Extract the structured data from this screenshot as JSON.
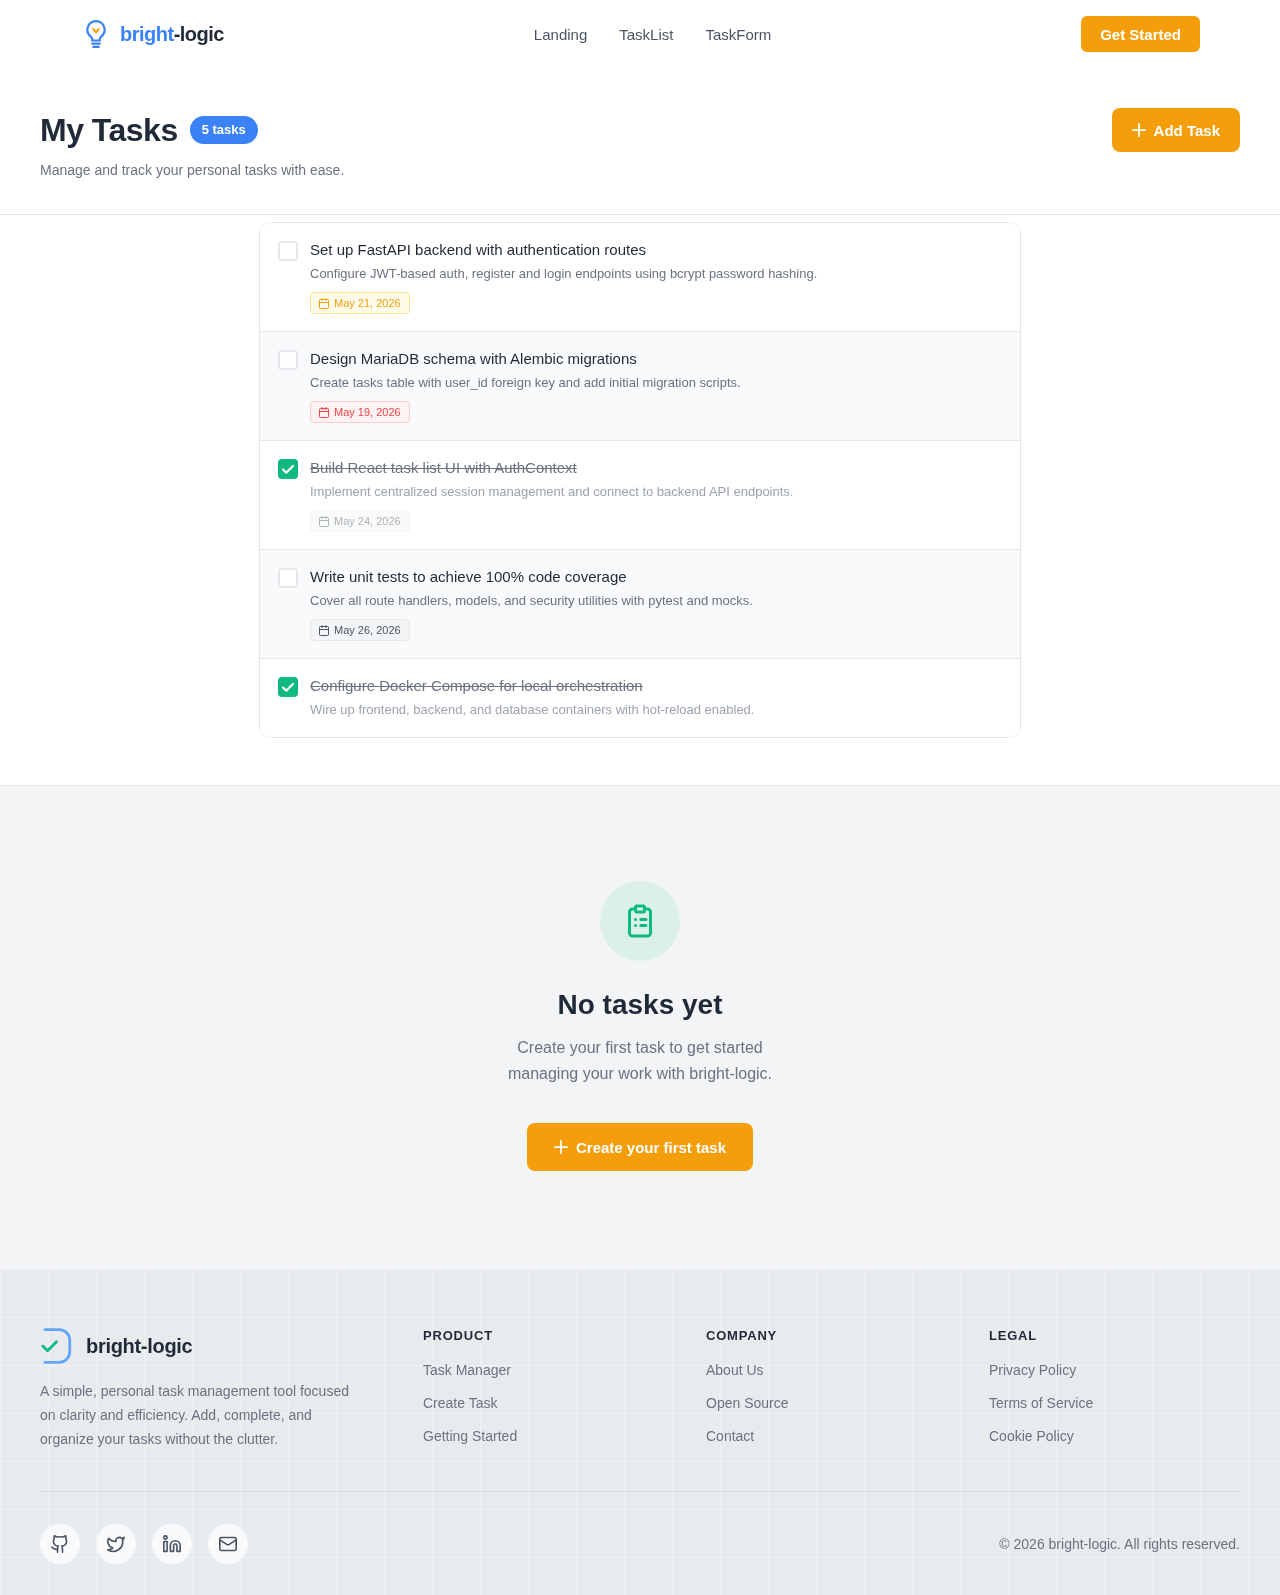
{
  "header": {
    "brand": {
      "highlight": "bright",
      "rest": "-logic"
    },
    "nav": [
      "Landing",
      "TaskList",
      "TaskForm"
    ],
    "cta": "Get Started"
  },
  "page_header": {
    "title": "My Tasks",
    "count_badge": "5 tasks",
    "subtitle": "Manage and track your personal tasks with ease.",
    "add_button": "Add Task"
  },
  "tasks": [
    {
      "title": "Set up FastAPI backend with authentication routes",
      "description": "Configure JWT-based auth, register and login endpoints using bcrypt password hashing.",
      "completed": false,
      "due_date": "May 21, 2026",
      "due_soon": true,
      "overdue": false
    },
    {
      "title": "Design MariaDB schema with Alembic migrations",
      "description": "Create tasks table with user_id foreign key and add initial migration scripts.",
      "completed": false,
      "due_date": "May 19, 2026",
      "overdue": true
    },
    {
      "title": "Build React task list UI with AuthContext",
      "description": "Implement centralized session management and connect to backend API endpoints.",
      "completed": true,
      "due_date": "May 24, 2026",
      "due_soon": false,
      "overdue": false
    },
    {
      "title": "Write unit tests to achieve 100% code coverage",
      "description": "Cover all route handlers, models, and security utilities with pytest and mocks.",
      "completed": false,
      "due_date": "May 26, 2026",
      "due_soon": false,
      "overdue": false
    },
    {
      "title": "Configure Docker Compose for local orchestration",
      "description": "Wire up frontend, backend, and database containers with hot-reload enabled.",
      "completed": true
    }
  ],
  "empty_state": {
    "title": "No tasks yet",
    "message": "Create your first task to get started managing your work with bright-logic.",
    "button": "Create your first task"
  },
  "footer": {
    "brand": "bright-logic",
    "description": "A simple, personal task management tool focused on clarity and efficiency. Add, complete, and organize your tasks without the clutter.",
    "columns": [
      {
        "heading": "PRODUCT",
        "links": [
          "Task Manager",
          "Create Task",
          "Getting Started"
        ]
      },
      {
        "heading": "COMPANY",
        "links": [
          "About Us",
          "Open Source",
          "Contact"
        ]
      },
      {
        "heading": "LEGAL",
        "links": [
          "Privacy Policy",
          "Terms of Service",
          "Cookie Policy"
        ]
      }
    ],
    "copyright": "© 2026 bright-logic. All rights reserved."
  }
}
